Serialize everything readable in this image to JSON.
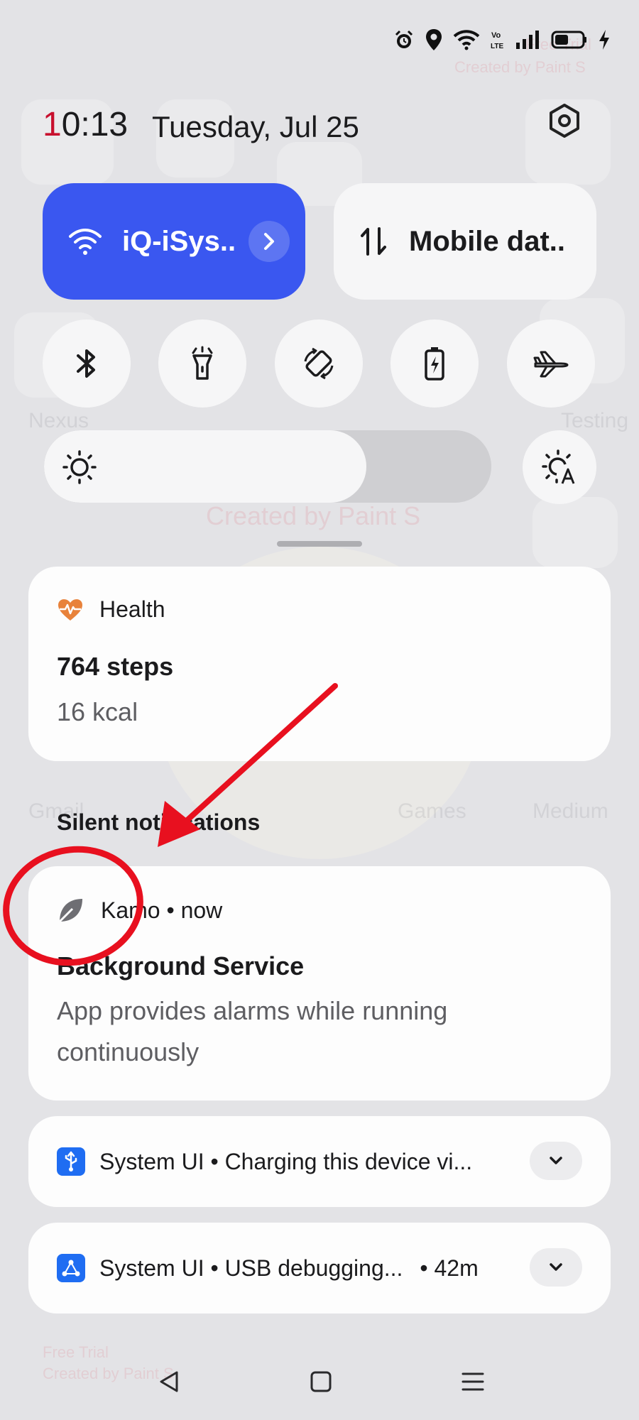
{
  "status_bar": {
    "icons": [
      "alarm-icon",
      "location-icon",
      "wifi-icon",
      "volte-icon",
      "signal-icon",
      "battery-icon",
      "charging-icon"
    ],
    "volte_label": "Vo LTE"
  },
  "header": {
    "time": "10:13",
    "date": "Tuesday, Jul 25"
  },
  "quick_settings": {
    "wifi_tile": {
      "label": "iQ-iSys..",
      "active": true,
      "color": "#3a57f0"
    },
    "mobile_data_tile": {
      "label": "Mobile dat..",
      "active": false
    },
    "toggles": [
      "bluetooth-icon",
      "flashlight-icon",
      "auto-rotate-icon",
      "battery-saver-icon",
      "airplane-mode-icon"
    ],
    "brightness_level": 0.72
  },
  "notifications": {
    "health": {
      "app": "Health",
      "title": "764 steps",
      "text": "16 kcal"
    },
    "section_title": "Silent notifications",
    "kamo": {
      "app": "Kamo",
      "time": "now",
      "app_line": "Kamo • now",
      "title": "Background Service",
      "text": "App provides alarms while running continuously"
    },
    "system_ui_charging": {
      "text": "System UI • Charging this device vi..."
    },
    "system_ui_usb": {
      "text": "System UI • USB debugging...",
      "time": "• 42m"
    }
  },
  "watermarks": {
    "free_trial": "Free Trial",
    "created_by": "Created by Paint S"
  },
  "annotation_color": "#e8101f"
}
